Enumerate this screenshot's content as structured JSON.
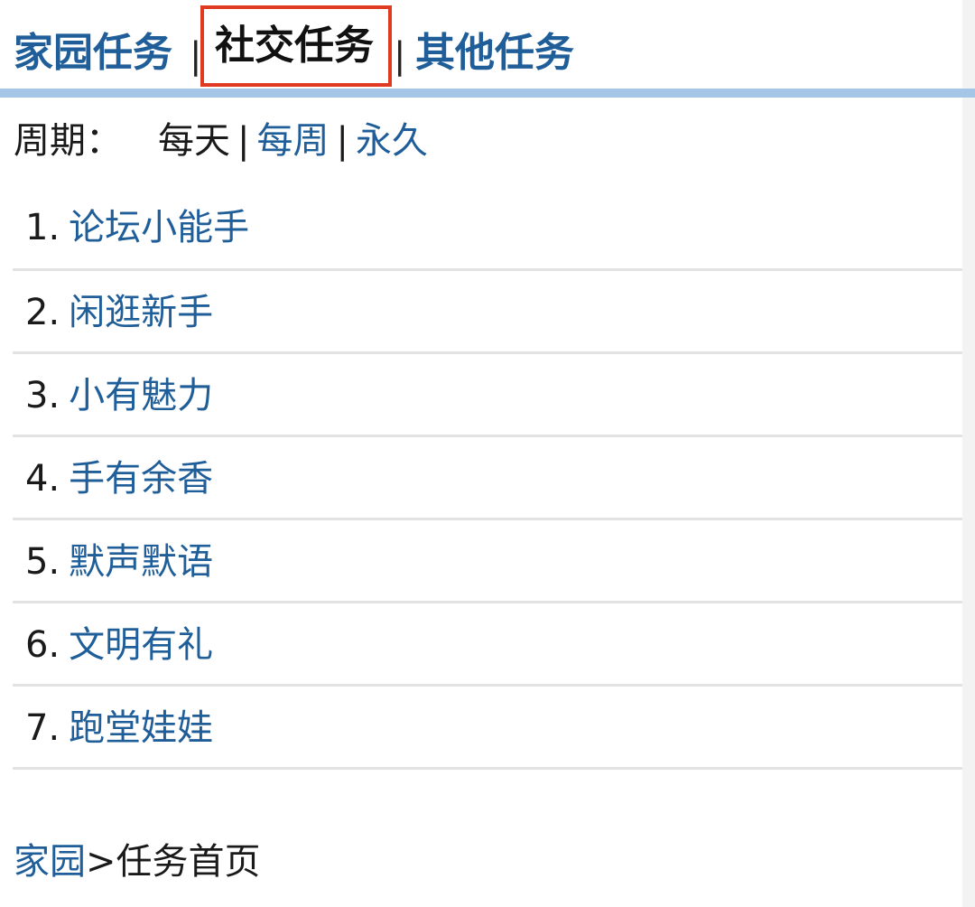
{
  "tabs": {
    "home": "家园任务",
    "social": "社交任务",
    "other": "其他任务",
    "separator": "|"
  },
  "period": {
    "label": "周期：",
    "current": "每天",
    "weekly": "每周",
    "permanent": "永久",
    "separator": "|"
  },
  "tasks": [
    {
      "num": "1.",
      "name": "论坛小能手"
    },
    {
      "num": "2.",
      "name": "闲逛新手"
    },
    {
      "num": "3.",
      "name": "小有魅力"
    },
    {
      "num": "4.",
      "name": "手有余香"
    },
    {
      "num": "5.",
      "name": "默声默语"
    },
    {
      "num": "6.",
      "name": "文明有礼"
    },
    {
      "num": "7.",
      "name": "跑堂娃娃"
    }
  ],
  "breadcrumb": {
    "home": "家园",
    "rest": ">任务首页"
  },
  "colors": {
    "link": "#1f5e99",
    "highlight_border": "#e03a22",
    "underline": "#a5c6e6"
  }
}
